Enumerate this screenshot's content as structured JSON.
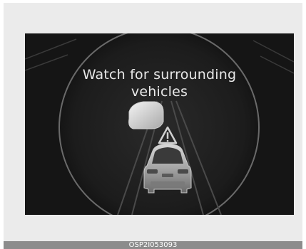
{
  "display": {
    "message_line1": "Watch for surrounding",
    "message_line2": "vehicles",
    "warning_icon": "warning-triangle-icon",
    "colors": {
      "background": "#151515",
      "text": "#e8e8e8",
      "frame": "#ebebeb"
    }
  },
  "caption": {
    "code": "OSP2I053093",
    "bar_color": "#8c8c8c"
  }
}
